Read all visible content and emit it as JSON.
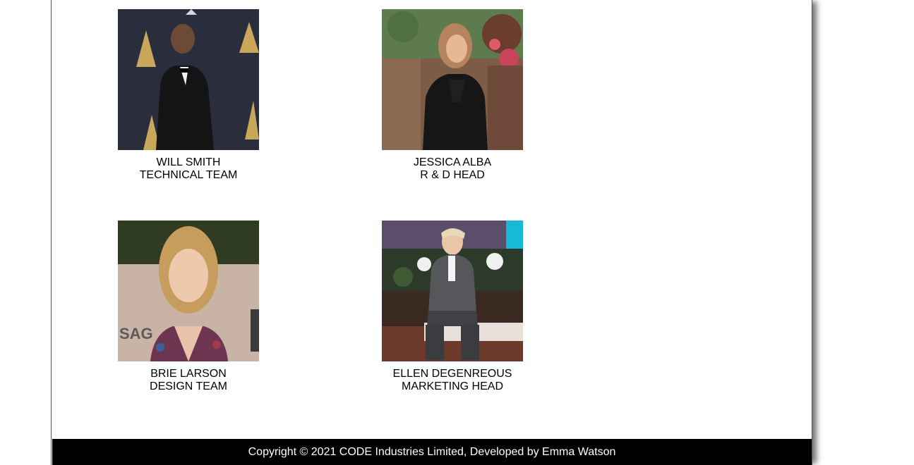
{
  "team": [
    {
      "name": "WILL SMITH",
      "role": "TECHNICAL TEAM",
      "photo": "person-photo"
    },
    {
      "name": "JESSICA ALBA",
      "role": "R & D HEAD",
      "photo": "person-photo"
    },
    {
      "name": "BRIE LARSON",
      "role": "DESIGN TEAM",
      "photo": "person-photo"
    },
    {
      "name": "ELLEN DEGENREOUS",
      "role": "MARKETING HEAD",
      "photo": "person-photo"
    }
  ],
  "footer": {
    "text": "Copyright © 2021 CODE Industries Limited, Developed by Emma Watson"
  },
  "colors": {
    "footer_bg": "#000000",
    "footer_text": "#ffffff",
    "page_bg": "#ffffff"
  }
}
